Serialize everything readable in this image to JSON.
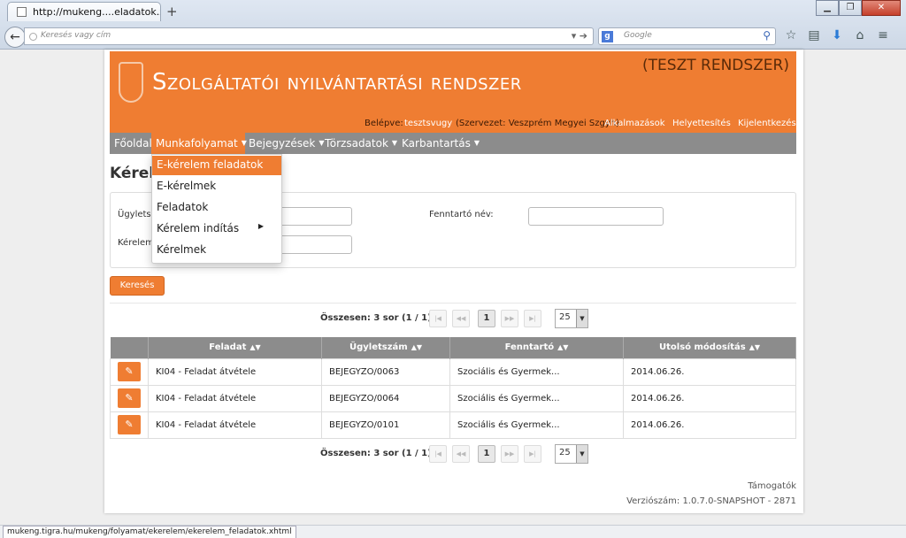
{
  "browser": {
    "tab_title": "http://mukeng....eladatok.xhtml",
    "url_placeholder": "Keresés vagy cím",
    "search_engine": "Google",
    "status_url": "mukeng.tigra.hu/mukeng/folyamat/ekerelem/ekerelem_feladatok.xhtml"
  },
  "header": {
    "title": "Szolgáltatói nyilvántartási rendszer",
    "test_label": "(TESZT RENDSZER)"
  },
  "userbar": {
    "logged_in_label": "Belépve:",
    "username": "tesztsvugy",
    "organization": "(Szervezet: Veszprém Megyei Szgyh)",
    "links": [
      "Alkalmazások",
      "Helyettesítés",
      "Kijelentkezés"
    ]
  },
  "menu": {
    "items": [
      "Főoldal",
      "Munkafolyamat",
      "Bejegyzések",
      "Törzsadatok",
      "Karbantartás"
    ],
    "dropdown": [
      "E-kérelem feladatok",
      "E-kérelmek",
      "Feladatok",
      "Kérelem indítás",
      "Kérelmek"
    ]
  },
  "page": {
    "title_visible": "Kérele"
  },
  "form": {
    "label_ugyletszam": "Ügyletsz",
    "label_kerelem": "Kérelem",
    "label_fenntarto": "Fenntartó név:",
    "search_button": "Keresés"
  },
  "pager": {
    "total": "Összesen: 3 sor (1 / 1)",
    "current_page": "1",
    "page_size": "25",
    "first_icon": "|◀",
    "prev_icon": "◀◀",
    "next_icon": "▶▶",
    "last_icon": "▶|"
  },
  "table": {
    "columns": [
      "Feladat",
      "Ügyletszám",
      "Fenntartó",
      "Utolsó módosítás"
    ],
    "rows": [
      {
        "feladat": "KI04 - Feladat átvétele",
        "ugyletszam": "BEJEGYZO/0063",
        "fenntarto": "Szociális és Gyermek...",
        "modositas": "2014.06.26."
      },
      {
        "feladat": "KI04 - Feladat átvétele",
        "ugyletszam": "BEJEGYZO/0064",
        "fenntarto": "Szociális és Gyermek...",
        "modositas": "2014.06.26."
      },
      {
        "feladat": "KI04 - Feladat átvétele",
        "ugyletszam": "BEJEGYZO/0101",
        "fenntarto": "Szociális és Gyermek...",
        "modositas": "2014.06.26."
      }
    ]
  },
  "footer": {
    "support": "Támogatók",
    "version": "Verziószám: 1.0.7.0-SNAPSHOT - 2871"
  },
  "colors": {
    "accent": "#ef7d32",
    "menubar": "#8c8c8c"
  }
}
